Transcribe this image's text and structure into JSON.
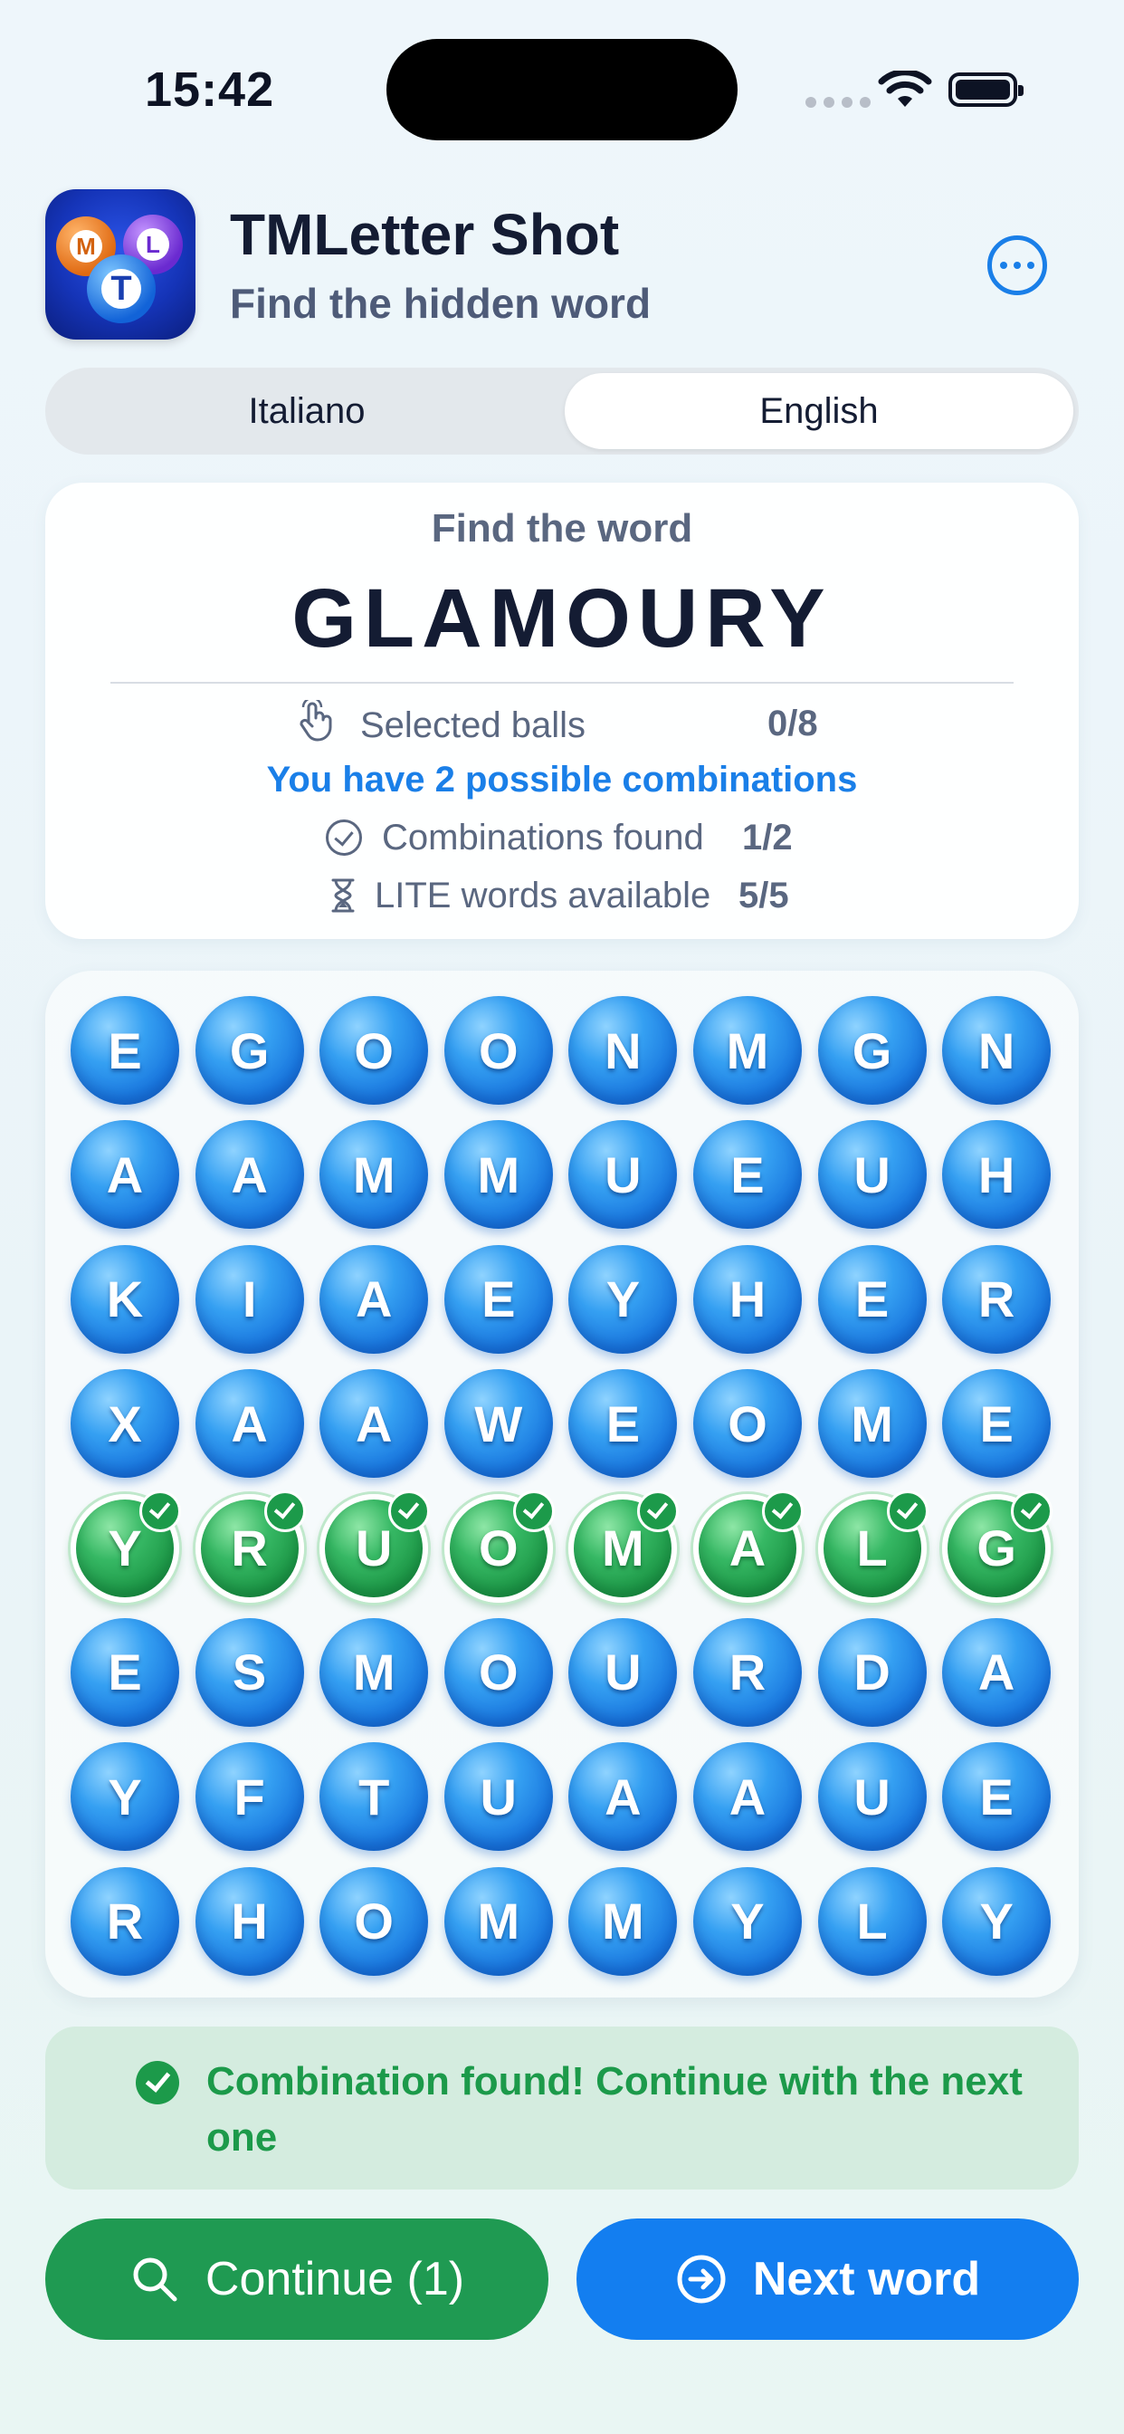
{
  "status_bar": {
    "time": "15:42"
  },
  "header": {
    "app_icon_letters": [
      "M",
      "L",
      "T"
    ],
    "title": "TMLetter Shot",
    "subtitle": "Find the hidden word",
    "more_icon": "ellipsis-circle-icon"
  },
  "language_tabs": {
    "items": [
      "Italiano",
      "English"
    ],
    "selected": "English"
  },
  "word_card": {
    "label": "Find the word",
    "word": "GLAMOURY",
    "selected_balls_label": "Selected balls",
    "selected_balls_value": "0/8",
    "combinations_text": "You have 2 possible combinations",
    "combinations_found_label": "Combinations found",
    "combinations_found_value": "1/2",
    "lite_words_label": "LITE words available",
    "lite_words_value": "5/5"
  },
  "grid": {
    "rows": [
      [
        "E",
        "G",
        "O",
        "O",
        "N",
        "M",
        "G",
        "N"
      ],
      [
        "A",
        "A",
        "M",
        "M",
        "U",
        "E",
        "U",
        "H"
      ],
      [
        "K",
        "I",
        "A",
        "E",
        "Y",
        "H",
        "E",
        "R"
      ],
      [
        "X",
        "A",
        "A",
        "W",
        "E",
        "O",
        "M",
        "E"
      ],
      [
        "Y",
        "R",
        "U",
        "O",
        "M",
        "A",
        "L",
        "G"
      ],
      [
        "E",
        "S",
        "M",
        "O",
        "U",
        "R",
        "D",
        "A"
      ],
      [
        "Y",
        "F",
        "T",
        "U",
        "A",
        "A",
        "U",
        "E"
      ],
      [
        "R",
        "H",
        "O",
        "M",
        "M",
        "Y",
        "L",
        "Y"
      ]
    ],
    "found_row_index": 4,
    "colors": {
      "ball": "#1a78df",
      "found": "#1f9a49"
    }
  },
  "banner": {
    "text": "Combination found! Continue with the next one",
    "icon": "checkmark-circle-icon"
  },
  "buttons": {
    "continue_label": "Continue (1)",
    "continue_icon": "search-icon",
    "next_label": "Next word",
    "next_icon": "arrow-right-circle-icon"
  }
}
